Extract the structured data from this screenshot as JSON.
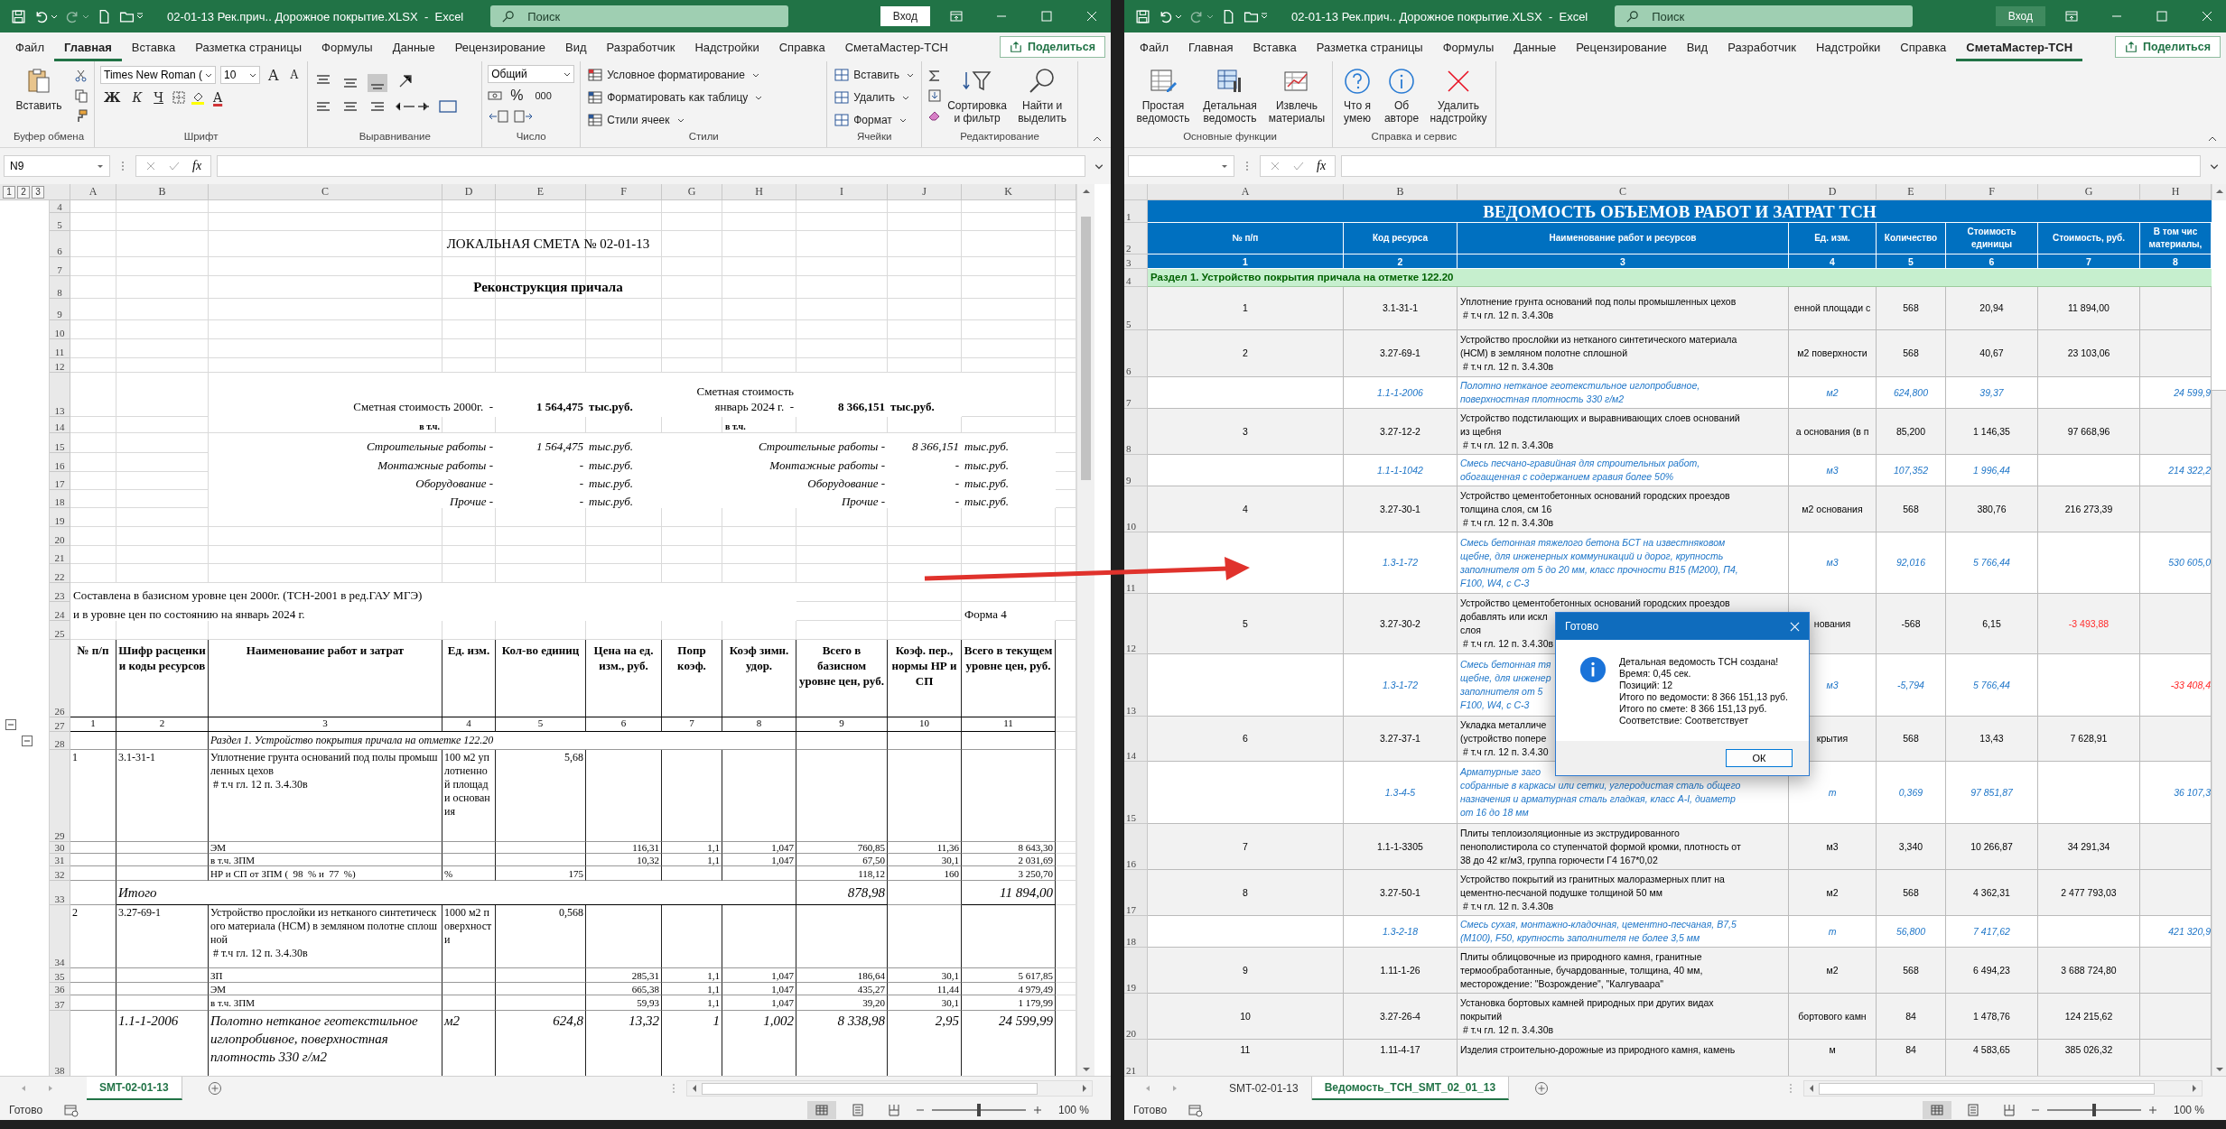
{
  "windows": [
    {
      "title": "02-01-13 Рек.прич.. Дорожное покрытие.XLSX  -  Excel",
      "search": {
        "placeholder": "Поиск"
      },
      "sign_in": "Вход",
      "tabs": [
        {
          "label": "Файл",
          "selected": false
        },
        {
          "label": "Главная",
          "selected": true
        },
        {
          "label": "Вставка",
          "selected": false
        },
        {
          "label": "Разметка страницы",
          "selected": false
        },
        {
          "label": "Формулы",
          "selected": false
        },
        {
          "label": "Данные",
          "selected": false
        },
        {
          "label": "Рецензирование",
          "selected": false
        },
        {
          "label": "Вид",
          "selected": false
        },
        {
          "label": "Разработчик",
          "selected": false
        },
        {
          "label": "Надстройки",
          "selected": false
        },
        {
          "label": "Справка",
          "selected": false
        },
        {
          "label": "СметаМастер-ТСН",
          "selected": false
        }
      ],
      "share": "Поделиться",
      "ribbon": {
        "kind": "home",
        "groups": [
          {
            "label": "Буфер обмена",
            "buttons": [
              "Вставить"
            ]
          },
          {
            "label": "Шрифт",
            "font": "Times New Roman (",
            "size": "10",
            "size_keys": [
              "A",
              "A"
            ],
            "keys": [
              "Ж",
              "К",
              "Ч"
            ],
            "font_color": "A"
          },
          {
            "label": "Выравнивание"
          },
          {
            "label": "Число",
            "format": "Общий",
            "keys": [
              "%",
              "000"
            ]
          },
          {
            "label": "Стили",
            "buttons": [
              "Условное форматирование",
              "Форматировать как таблицу",
              "Стили ячеек"
            ]
          },
          {
            "label": "Ячейки",
            "buttons": [
              "Вставить",
              "Удалить",
              "Формат"
            ]
          },
          {
            "label": "Редактирование",
            "buttons": [
              "Сортировка и фильтр",
              "Найти и выделить"
            ]
          }
        ]
      },
      "name_box": "N9",
      "fx": "fx",
      "sheet": {
        "kind": "estimate",
        "columns": [
          "A",
          "B",
          "C",
          "D",
          "E",
          "F",
          "G",
          "H",
          "I",
          "J",
          "K"
        ],
        "row_numbers": [
          "4",
          "5",
          "6",
          "7",
          "8",
          "9",
          "10",
          "11",
          "12",
          "13",
          "14",
          "15",
          "16",
          "17",
          "18",
          "19",
          "20",
          "21",
          "22",
          "23",
          "24",
          "25",
          "26",
          "27",
          "28",
          "29",
          "30",
          "31",
          "32",
          "33",
          "34",
          "35",
          "36",
          "37",
          "38"
        ],
        "outline_levels": [
          "1",
          "2",
          "3"
        ],
        "title": "ЛОКАЛЬНАЯ СМЕТА № 02-01-13",
        "object": "Реконструкция причала",
        "base_cost": {
          "label": "Сметная стоимость 2000г.  -",
          "value": "1 564,475",
          "unit": "тыс.руб.",
          "including": "в т.ч."
        },
        "current_cost": {
          "label": [
            "Сметная стоимость",
            "январь 2024 г.  -"
          ],
          "value": "8 366,151",
          "unit": "тыс.руб.",
          "including": "в т.ч."
        },
        "breakdown": [
          {
            "base_label": "Строительные работы -",
            "base_value": "1 564,475",
            "base_unit": "тыс.руб.",
            "current_label": "Строительные работы -",
            "current_value": "8 366,151",
            "current_unit": "тыс.руб."
          },
          {
            "base_label": "Монтажные работы -",
            "base_value": "-",
            "base_unit": "тыс.руб.",
            "current_label": "Монтажные работы -",
            "current_value": "-",
            "current_unit": "тыс.руб."
          },
          {
            "base_label": "Оборудование -",
            "base_value": "-",
            "base_unit": "тыс.руб.",
            "current_label": "Оборудование -",
            "current_value": "-",
            "current_unit": "тыс.руб."
          },
          {
            "base_label": "Прочие -",
            "base_value": "-",
            "base_unit": "тыс.руб.",
            "current_label": "Прочие -",
            "current_value": "-",
            "current_unit": "тыс.руб."
          }
        ],
        "notes": [
          "Составлена в базисном уровне цен 2000г. (ТСН-2001 в ред.ГАУ МГЭ)",
          "и в уровне цен по состоянию на январь 2024 г."
        ],
        "form": "Форма 4",
        "table": {
          "headers": [
            "№ п/п",
            "Шифр расценки и коды ресурсов",
            "Наименование работ и затрат",
            "Ед. изм.",
            "Кол-во единиц",
            "Цена на ед. изм., руб.",
            "Попр коэф.",
            "Коэф зимн. удор.",
            "Всего в базисном уровне цен, руб.",
            "Коэф. пер., нормы НР и СП",
            "Всего в текущем уровне цен, руб."
          ],
          "numbers": [
            "1",
            "2",
            "3",
            "4",
            "5",
            "6",
            "7",
            "8",
            "9",
            "10",
            "11"
          ],
          "section": "Раздел 1. Устройство покрытия причала на отметке 122.20",
          "items": [
            {
              "number": "1",
              "code": "3.1-31-1",
              "name": "Уплотнение грунта оснований под полы промышленных цехов",
              "note": " # т.ч гл. 12 п. 3.4.30в",
              "unit": "100 м2 уплотненной площади основания",
              "quantity": "5,68",
              "lines": [
                {
                  "name": "ЭМ",
                  "price": "116,31",
                  "correction": "1,1",
                  "winter": "1,047",
                  "base": "760,85",
                  "index": "11,36",
                  "current": "8 643,30"
                },
                {
                  "name": "в т.ч. ЗПМ",
                  "price": "10,32",
                  "correction": "1,1",
                  "winter": "1,047",
                  "base": "67,50",
                  "index": "30,1",
                  "current": "2 031,69"
                },
                {
                  "name": "НР и СП от ЗПМ (  98  % и  77  %)",
                  "unit": "%",
                  "quantity": "175",
                  "base": "118,12",
                  "index": "160",
                  "current": "3 250,70"
                }
              ],
              "total": {
                "label": "Итого",
                "base": "878,98",
                "current": "11 894,00"
              }
            },
            {
              "number": "2",
              "code": "3.27-69-1",
              "name": "Устройство прослойки из нетканого синтетического материала (НСМ) в земляном полотне сплошной",
              "note": " # т.ч гл. 12 п. 3.4.30в",
              "unit": "1000 м2 поверхности",
              "quantity": "0,568",
              "lines": [
                {
                  "name": "ЗП",
                  "price": "285,31",
                  "correction": "1,1",
                  "winter": "1,047",
                  "base": "186,64",
                  "index": "30,1",
                  "current": "5 617,85"
                },
                {
                  "name": "ЭМ",
                  "price": "665,38",
                  "correction": "1,1",
                  "winter": "1,047",
                  "base": "435,27",
                  "index": "11,44",
                  "current": "4 979,49"
                },
                {
                  "name": "в т.ч. ЗПМ",
                  "price": "59,93",
                  "correction": "1,1",
                  "winter": "1,047",
                  "base": "39,20",
                  "index": "30,1",
                  "current": "1 179,99"
                }
              ],
              "resources": [
                {
                  "code": "1.1-1-2006",
                  "name": "Полотно нетканое геотекстильное иглопробивное, поверхностная плотность 330 г/м2",
                  "unit": "м2",
                  "quantity": "624,8",
                  "price": "13,32",
                  "correction": "1",
                  "winter": "1,002",
                  "base": "8 338,98",
                  "index": "2,95",
                  "current": "24 599,99"
                }
              ]
            }
          ]
        }
      },
      "sheet_tabs": [
        {
          "label": "SMT-02-01-13",
          "selected": true
        }
      ],
      "status": "Готово",
      "zoom": {
        "label": "100 %",
        "level": 0.5
      }
    },
    {
      "title": "02-01-13 Рек.прич.. Дорожное покрытие.XLSX  -  Excel",
      "search": {
        "placeholder": "Поиск"
      },
      "sign_in": "Вход",
      "tabs": [
        {
          "label": "Файл",
          "selected": false
        },
        {
          "label": "Главная",
          "selected": false
        },
        {
          "label": "Вставка",
          "selected": false
        },
        {
          "label": "Разметка страницы",
          "selected": false
        },
        {
          "label": "Формулы",
          "selected": false
        },
        {
          "label": "Данные",
          "selected": false
        },
        {
          "label": "Рецензирование",
          "selected": false
        },
        {
          "label": "Вид",
          "selected": false
        },
        {
          "label": "Разработчик",
          "selected": false
        },
        {
          "label": "Надстройки",
          "selected": false
        },
        {
          "label": "Справка",
          "selected": false
        },
        {
          "label": "СметаМастер-ТСН",
          "selected": true
        }
      ],
      "share": "Поделиться",
      "ribbon": {
        "kind": "addin",
        "groups": [
          {
            "label": "Основные функции",
            "buttons": [
              "Простая ведомость",
              "Детальная ведомость",
              "Извлечь материалы"
            ]
          },
          {
            "label": "Справка и сервис",
            "buttons": [
              "Что я умею",
              "Об авторе",
              "Удалить надстройку"
            ]
          }
        ]
      },
      "fx": "fx",
      "sheet": {
        "kind": "statement",
        "columns": [
          "A",
          "B",
          "C",
          "D",
          "E",
          "F",
          "G",
          "H"
        ],
        "row_numbers": [
          "1",
          "2",
          "3",
          "4",
          "5",
          "6",
          "7",
          "8",
          "9",
          "10",
          "11",
          "12",
          "13",
          "14",
          "15",
          "16",
          "17",
          "18",
          "19",
          "20",
          "21"
        ],
        "title": "ВЕДОМОСТЬ ОБЪЕМОВ РАБОТ И ЗАТРАТ ТСН",
        "headers": [
          [
            "№ п/п"
          ],
          [
            "Код ресурса"
          ],
          [
            "Наименование работ и ресурсов"
          ],
          [
            "Ед. изм."
          ],
          [
            "Количество"
          ],
          [
            "Стоимость",
            "единицы"
          ],
          [
            "Стоимость, руб."
          ],
          [
            "В том чис",
            "материалы,"
          ]
        ],
        "numbers": [
          "1",
          "2",
          "3",
          "4",
          "5",
          "6",
          "7",
          "8"
        ],
        "section": "Раздел 1. Устройство покрытия причала на отметке 122.20",
        "rows": [
          {
            "kind": "work",
            "number": "1",
            "code": "3.1-31-1",
            "name": [
              "Уплотнение грунта оснований под полы промышленных цехов",
              " # т.ч гл. 12 п. 3.4.30в"
            ],
            "unit": "енной площади с",
            "quantity": "568",
            "price": "20,94",
            "cost": "11 894,00",
            "negative": false
          },
          {
            "kind": "work",
            "number": "2",
            "code": "3.27-69-1",
            "name": [
              "Устройство прослойки из нетканого синтетического материала",
              "(НСМ) в земляном полотне сплошной",
              " # т.ч гл. 12 п. 3.4.30в"
            ],
            "unit": "м2 поверхности",
            "quantity": "568",
            "price": "40,67",
            "cost": "23 103,06",
            "negative": false
          },
          {
            "kind": "resource",
            "code": "1.1-1-2006",
            "name": [
              "Полотно нетканое геотекстильное иглопробивное,",
              "поверхностная плотность 330 г/м2"
            ],
            "unit": "м2",
            "quantity": "624,800",
            "price": "39,37",
            "materials": "24 599,9",
            "negative": false
          },
          {
            "kind": "work",
            "number": "3",
            "code": "3.27-12-2",
            "name": [
              "Устройство подстилающих и выравнивающих слоев оснований",
              "из щебня",
              " # т.ч гл. 12 п. 3.4.30в"
            ],
            "unit": "а основания (в п",
            "quantity": "85,200",
            "price": "1 146,35",
            "cost": "97 668,96",
            "negative": false
          },
          {
            "kind": "resource",
            "code": "1.1-1-1042",
            "name": [
              "Смесь песчано-гравийная для строительных работ,",
              "обогащенная с содержанием гравия более 50%"
            ],
            "unit": "м3",
            "quantity": "107,352",
            "price": "1 996,44",
            "materials": "214 322,2",
            "negative": false
          },
          {
            "kind": "work",
            "number": "4",
            "code": "3.27-30-1",
            "name": [
              "Устройство цементобетонных оснований городских проездов",
              "толщина слоя, см 16",
              " # т.ч гл. 12 п. 3.4.30в"
            ],
            "unit": "м2 основания",
            "quantity": "568",
            "price": "380,76",
            "cost": "216 273,39",
            "negative": false
          },
          {
            "kind": "resource",
            "code": "1.3-1-72",
            "name": [
              "Смесь бетонная тяжелого бетона БСТ на известняковом",
              "щебне, для инженерных коммуникаций и дорог, крупность",
              "заполнителя от 5 до 20 мм, класс прочности B15 (М200), П4,",
              "F100, W4, с С-3"
            ],
            "unit": "м3",
            "quantity": "92,016",
            "price": "5 766,44",
            "materials": "530 605,0",
            "negative": false
          },
          {
            "kind": "work",
            "number": "5",
            "code": "3.27-30-2",
            "name": [
              "Устройство цементобетонных оснований городских проездов",
              "добавлять или искл",
              "слоя",
              " # т.ч гл. 12 п. 3.4.30в"
            ],
            "unit": "нования",
            "quantity": "-568",
            "price": "6,15",
            "cost": "-3 493,88",
            "negative": true
          },
          {
            "kind": "resource",
            "code": "1.3-1-72",
            "name": [
              "Смесь бетонная тя",
              "щебне, для инженер",
              "заполнителя от 5",
              "F100, W4, с С-3"
            ],
            "unit": "м3",
            "quantity": "-5,794",
            "price": "5 766,44",
            "materials": "-33 408,4",
            "negative": true
          },
          {
            "kind": "work",
            "number": "6",
            "code": "3.27-37-1",
            "name": [
              "Укладка металличе",
              "(устройство попере",
              " # т.ч гл. 12 п. 3.4.30"
            ],
            "unit": "крытия",
            "quantity": "568",
            "price": "13,43",
            "cost": "7 628,91",
            "negative": false
          },
          {
            "kind": "resource",
            "code": "1.3-4-5",
            "name": [
              "Арматурные заго",
              "собранные в каркасы или сетки, углеродистая сталь общего",
              "назначения и арматурная сталь гладкая, класс А-I, диаметр",
              "от 16 до 18 мм"
            ],
            "unit": "т",
            "quantity": "0,369",
            "price": "97 851,87",
            "materials": "36 107,3",
            "negative": false
          },
          {
            "kind": "work",
            "number": "7",
            "code": "1.1-1-3305",
            "name": [
              "Плиты теплоизоляционные из экструдированного",
              "пенополистирола со ступенчатой формой кромки, плотность от",
              "38 до 42 кг/м3, группа горючести Г4 167*0,02"
            ],
            "unit": "м3",
            "quantity": "3,340",
            "price": "10 266,87",
            "cost": "34 291,34",
            "negative": false
          },
          {
            "kind": "work",
            "number": "8",
            "code": "3.27-50-1",
            "name": [
              "Устройство покрытий из гранитных малоразмерных плит на",
              "цементно-песчаной подушке толщиной 50 мм",
              " # т.ч гл. 12 п. 3.4.30в"
            ],
            "unit": "м2",
            "quantity": "568",
            "price": "4 362,31",
            "cost": "2 477 793,03",
            "negative": false
          },
          {
            "kind": "resource",
            "code": "1.3-2-18",
            "name": [
              "Смесь сухая, монтажно-кладочная, цементно-песчаная, В7,5",
              "(М100), F50, крупность заполнителя не более 3,5 мм"
            ],
            "unit": "т",
            "quantity": "56,800",
            "price": "7 417,62",
            "materials": "421 320,9",
            "negative": false
          },
          {
            "kind": "work",
            "number": "9",
            "code": "1.11-1-26",
            "name": [
              "Плиты облицовочные из природного камня, гранитные",
              "термообработанные, бучардованные, толщина, 40 мм,",
              "месторождение: \"Возрождение\", \"Калгуваара\""
            ],
            "unit": "м2",
            "quantity": "568",
            "price": "6 494,23",
            "cost": "3 688 724,80",
            "negative": false
          },
          {
            "kind": "work",
            "number": "10",
            "code": "3.27-26-4",
            "name": [
              "Установка бортовых камней природных при других видах",
              "покрытий",
              " # т.ч гл. 12 п. 3.4.30в"
            ],
            "unit": "бортового камн",
            "quantity": "84",
            "price": "1 478,76",
            "cost": "124 215,62",
            "negative": false
          },
          {
            "kind": "work",
            "number": "11",
            "code": "1.11-4-17",
            "name": [
              "Изделия строительно-дорожные из природного камня, камень"
            ],
            "unit": "м",
            "quantity": "84",
            "price": "4 583,65",
            "cost": "385 026,32",
            "negative": false
          }
        ]
      },
      "sheet_tabs": [
        {
          "label": "SMT-02-01-13",
          "selected": false
        },
        {
          "label": "Ведомость_ТСН_SMT_02_01_13",
          "selected": true
        }
      ],
      "status": "Готово",
      "zoom": {
        "label": "100 %",
        "level": 0.5
      }
    }
  ],
  "dialog": {
    "title": "Готово",
    "lines": [
      "Детальная ведомость ТСН создана!",
      "Время: 0,45 сек.",
      "Позиций: 12",
      "Итого по ведомости: 8 366 151,13 руб.",
      "Итого по смете: 8 366 151,13 руб.",
      "Соответствие: Соответствует"
    ],
    "button": "ОК"
  }
}
